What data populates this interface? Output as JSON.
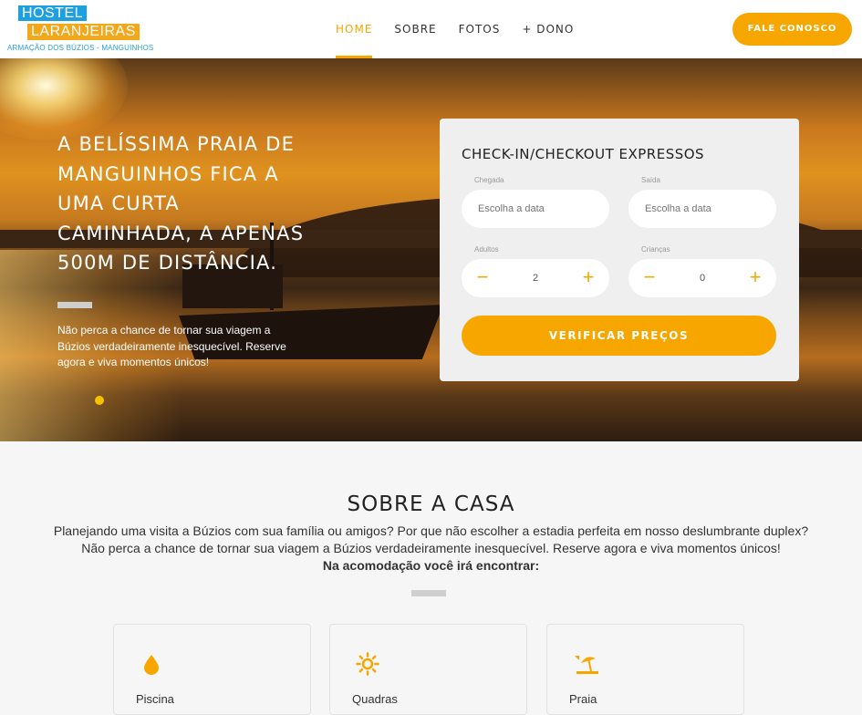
{
  "brand": {
    "line1": "HOSTEL",
    "line2": "LARANJEIRAS",
    "tagline": "ARMAÇÃO DOS BÚZIOS - MANGUINHOS"
  },
  "nav": {
    "items": [
      {
        "label": "HOME",
        "active": true
      },
      {
        "label": "SOBRE"
      },
      {
        "label": "FOTOS"
      },
      {
        "label": "+ DONO"
      }
    ],
    "cta": "FALE CONOSCO"
  },
  "hero": {
    "title": "A BELÍSSIMA PRAIA DE MANGUINHOS FICA A UMA CURTA CAMINHADA, A APENAS 500M DE DISTÂNCIA.",
    "text": "Não perca a chance de tornar sua viagem a Búzios verdadeiramente inesquecível. Reserve agora e viva momentos únicos!"
  },
  "booking": {
    "title": "CHECK-IN/CHECKOUT EXPRESSOS",
    "checkin_label": "Chegada",
    "checkin_placeholder": "Escolha a data",
    "checkout_label": "Saída",
    "checkout_placeholder": "Escolha a data",
    "adults_label": "Adultos",
    "adults_value": "2",
    "children_label": "Crianças",
    "children_value": "0",
    "minus": "−",
    "plus": "+",
    "submit": "VERIFICAR PREÇOS"
  },
  "about": {
    "title": "SOBRE A CASA",
    "line1": "Planejando uma visita a Búzios com sua família ou amigos? Por que não escolher a estadia perfeita em nosso deslumbrante duplex?",
    "line2": "Não perca a chance de tornar sua viagem a Búzios verdadeiramente inesquecível. Reserve agora e viva momentos únicos!",
    "line3": "Na acomodação você irá encontrar:",
    "features": [
      {
        "label": "Piscina",
        "icon": "water-drop-icon"
      },
      {
        "label": "Quadras",
        "icon": "sun-icon"
      },
      {
        "label": "Praia",
        "icon": "beach-umbrella-icon"
      }
    ]
  },
  "colors": {
    "accent": "#f7a600",
    "brand_blue": "#1e9fe0"
  }
}
